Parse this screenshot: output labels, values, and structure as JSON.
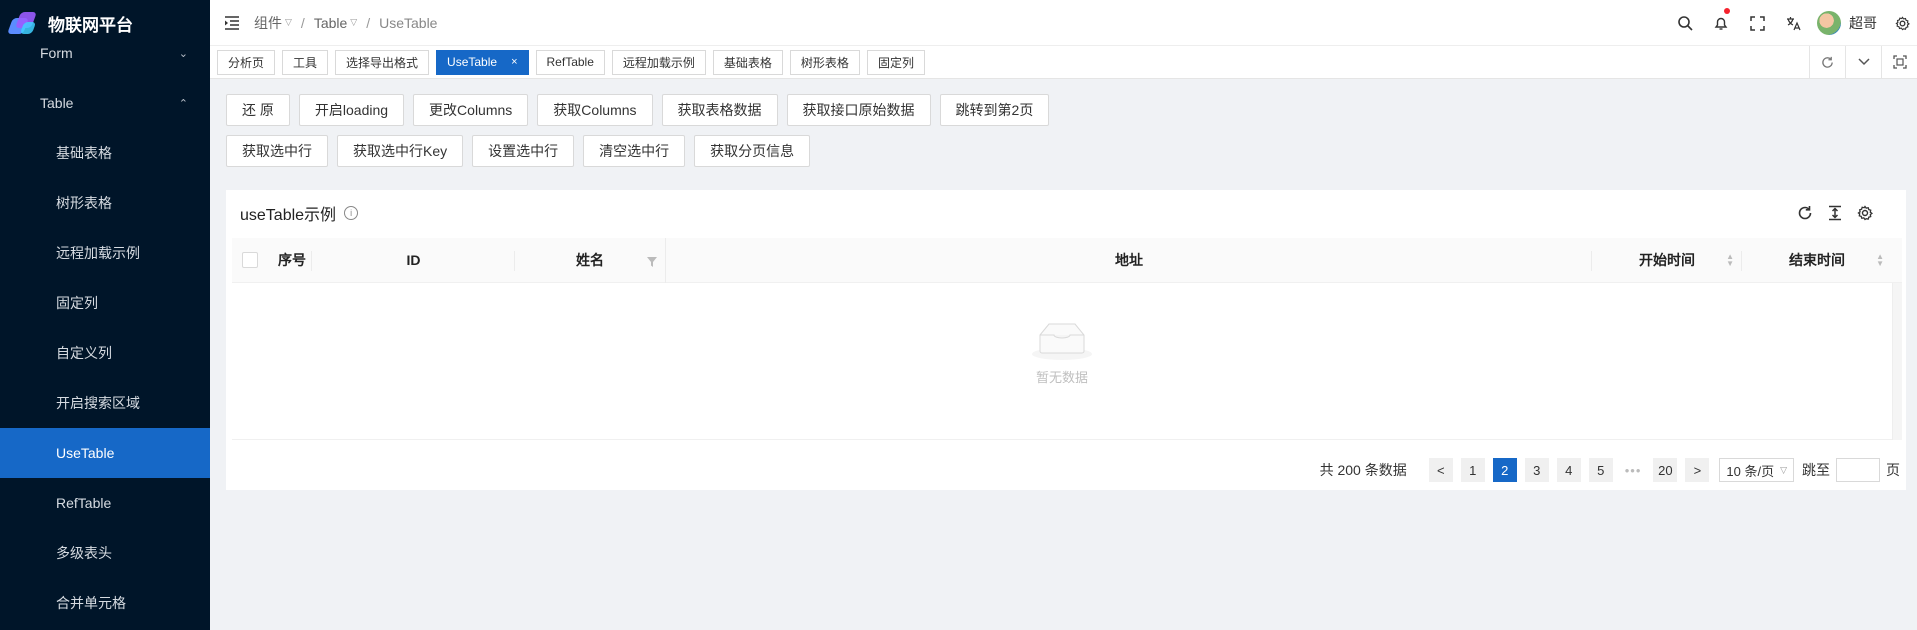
{
  "app": {
    "title": "物联网平台"
  },
  "sidebar": {
    "items": [
      {
        "label": "Form",
        "level": "top",
        "arrow": "⌄",
        "active": false
      },
      {
        "label": "Table",
        "level": "top",
        "arrow": "⌃",
        "active": false
      },
      {
        "label": "基础表格",
        "level": "sub",
        "active": false
      },
      {
        "label": "树形表格",
        "level": "sub",
        "active": false
      },
      {
        "label": "远程加载示例",
        "level": "sub",
        "active": false
      },
      {
        "label": "固定列",
        "level": "sub",
        "active": false
      },
      {
        "label": "自定义列",
        "level": "sub",
        "active": false
      },
      {
        "label": "开启搜索区域",
        "level": "sub",
        "active": false
      },
      {
        "label": "UseTable",
        "level": "sub",
        "active": true
      },
      {
        "label": "RefTable",
        "level": "sub",
        "active": false
      },
      {
        "label": "多级表头",
        "level": "sub",
        "active": false
      },
      {
        "label": "合并单元格",
        "level": "sub",
        "active": false
      }
    ]
  },
  "header": {
    "breadcrumb": [
      "组件",
      "Table",
      "UseTable"
    ],
    "username": "超哥",
    "icons": [
      "search-icon",
      "bell-icon",
      "fullscreen-icon",
      "translate-icon",
      "settings-icon"
    ]
  },
  "tabs": [
    {
      "label": "分析页",
      "active": false
    },
    {
      "label": "工具",
      "active": false
    },
    {
      "label": "选择导出格式",
      "active": false
    },
    {
      "label": "UseTable",
      "active": true,
      "close": "×"
    },
    {
      "label": "RefTable",
      "active": false
    },
    {
      "label": "远程加载示例",
      "active": false
    },
    {
      "label": "基础表格",
      "active": false
    },
    {
      "label": "树形表格",
      "active": false
    },
    {
      "label": "固定列",
      "active": false
    }
  ],
  "actions": {
    "row1": [
      "还 原",
      "开启loading",
      "更改Columns",
      "获取Columns",
      "获取表格数据",
      "获取接口原始数据",
      "跳转到第2页"
    ],
    "row2": [
      "获取选中行",
      "获取选中行Key",
      "设置选中行",
      "清空选中行",
      "获取分页信息"
    ]
  },
  "table": {
    "title": "useTable示例",
    "columns": [
      {
        "label": "序号"
      },
      {
        "label": "ID"
      },
      {
        "label": "姓名"
      },
      {
        "label": "地址"
      },
      {
        "label": "开始时间"
      },
      {
        "label": "结束时间"
      }
    ],
    "empty_text": "暂无数据"
  },
  "pagination": {
    "total_text": "共 200 条数据",
    "prev": "<",
    "next": ">",
    "pages": [
      "1",
      "2",
      "3",
      "4",
      "5"
    ],
    "ellipsis": "•••",
    "last_page": "20",
    "current": "2",
    "page_size": "10 条/页",
    "jump_label": "跳至",
    "page_suffix": "页"
  },
  "colors": {
    "primary": "#1668c7",
    "sidebar_bg": "#001529"
  }
}
